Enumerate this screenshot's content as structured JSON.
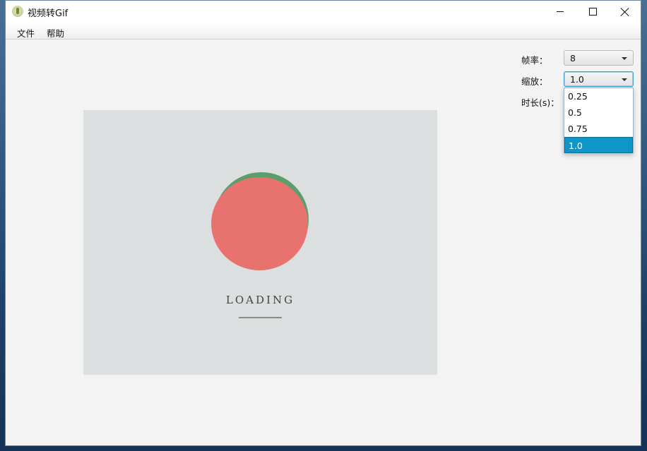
{
  "window": {
    "title": "视频转Gif"
  },
  "menu": {
    "file": "文件",
    "help": "帮助"
  },
  "preview": {
    "loading_text": "LOADING"
  },
  "controls": {
    "fps": {
      "label": "帧率：",
      "value": "8"
    },
    "scale": {
      "label": "缩放：",
      "value": "1.0",
      "options": [
        "0.25",
        "0.5",
        "0.75",
        "1.0"
      ],
      "selected_index": 3
    },
    "duration": {
      "label": "时长(s)："
    }
  },
  "colors": {
    "selection": "#0f96c8",
    "focus_border": "#3f9bd0",
    "loader_red": "#e8736e",
    "loader_green": "#5a9e6b",
    "preview_bg": "#dcdfe0"
  },
  "icons": {
    "app": "app-icon",
    "minimize": "minimize-icon",
    "maximize": "maximize-icon",
    "close": "close-icon",
    "dropdown_arrow": "chevron-down-icon"
  }
}
